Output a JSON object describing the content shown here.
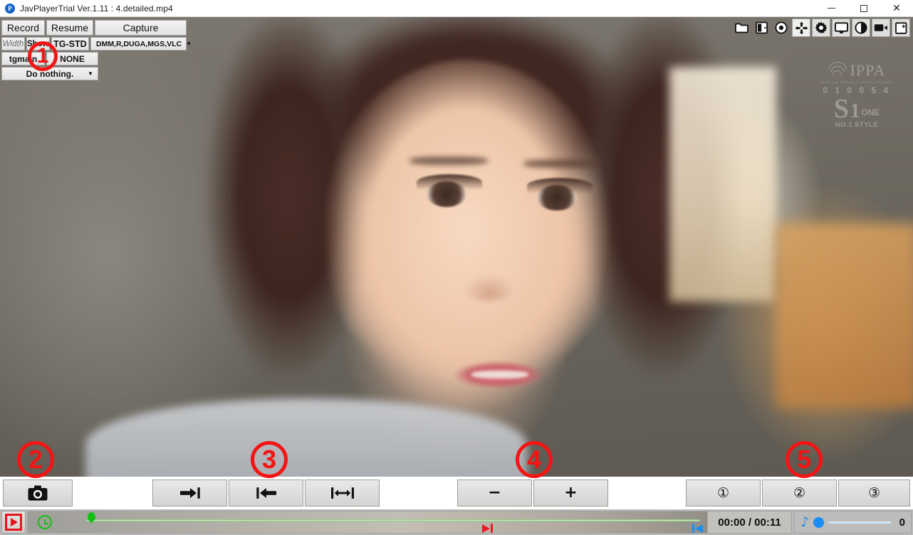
{
  "window": {
    "title": "JavPlayerTrial Ver.1.11 : 4.detailed.mp4",
    "logo_glyph": "P",
    "minimize_label": "Minimize",
    "maximize_label": "Maximize",
    "close_label": "Close",
    "close_glyph": "✕"
  },
  "control_panel": {
    "record_label": "Record",
    "resume_label": "Resume",
    "capture_label": "Capture",
    "width_label": "Width",
    "show_label": "Show",
    "tg_std_label": "TG-STD",
    "tgmain_label": "tgmain",
    "none_label": "NONE",
    "site_combo_value": "DMM,R,DUGA,MGS,VLC",
    "action_combo_value": "Do nothing.",
    "caret_glyph": "▼"
  },
  "icon_bar": {
    "items": [
      {
        "name": "folder-icon",
        "label": "Open folder"
      },
      {
        "name": "book-icon",
        "label": "Library"
      },
      {
        "name": "record-dot-icon",
        "label": "Record"
      },
      {
        "name": "move-icon",
        "label": "Move / pan",
        "active": true
      },
      {
        "name": "gear-icon",
        "label": "Settings",
        "framed": true
      },
      {
        "name": "monitor-icon",
        "label": "Display",
        "framed": true
      },
      {
        "name": "contrast-icon",
        "label": "Contrast",
        "framed": true
      },
      {
        "name": "camcorder-icon",
        "label": "Video",
        "framed": true
      },
      {
        "name": "add-frame-icon",
        "label": "Add frame",
        "framed": true
      }
    ]
  },
  "video": {
    "watermark": {
      "ippa_text": "IPPA",
      "ippa_sub": "Intellectual Property Promotion Association",
      "ippa_number": "0 1 0 0 5 4",
      "s_letter": "S",
      "one_number": "1",
      "one_word": "ONE",
      "style_text": "NO.1 STYLE"
    }
  },
  "button_bar": {
    "camera_glyph": "📷",
    "camera_label": "Capture snapshot",
    "forward_glyph": "➔|",
    "forward_label": "Step forward",
    "back_glyph": "|⬅",
    "back_label": "Step back",
    "span_glyph": "|↔|",
    "span_label": "Set range",
    "minus_glyph": "−",
    "minus_label": "Decrease",
    "plus_glyph": "+",
    "plus_label": "Increase",
    "preset_one_glyph": "①",
    "preset_one_label": "Preset 1",
    "preset_two_glyph": "②",
    "preset_two_label": "Preset 2",
    "preset_three_glyph": "③",
    "preset_three_label": "Preset 3"
  },
  "status_bar": {
    "play_label": "Play",
    "clock_label": "Timer",
    "seek_label": "Seek bar",
    "time_text": "00:00 / 00:11",
    "start_marker_label": "Range start marker",
    "end_marker_label": "Range end marker",
    "volume_icon_glyph": "♪",
    "volume_value": "0",
    "volume_label": "Volume"
  },
  "annotations": [
    {
      "id": "annotation-1",
      "label": "1"
    },
    {
      "id": "annotation-2",
      "label": "2"
    },
    {
      "id": "annotation-3",
      "label": "3"
    },
    {
      "id": "annotation-4",
      "label": "4"
    },
    {
      "id": "annotation-5",
      "label": "5"
    }
  ],
  "colors": {
    "accent_red": "#f41414",
    "accent_blue": "#1a8ef5",
    "accent_green": "#12c012",
    "titlebar_bg": "#ffffff",
    "statusbar_bg": "#b9b9b7"
  }
}
